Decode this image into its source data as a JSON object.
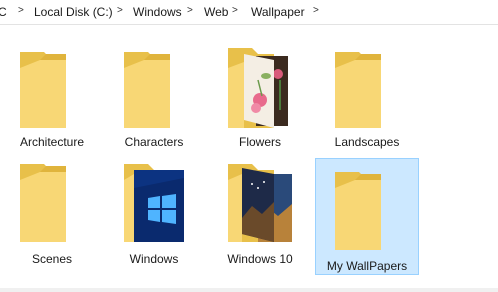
{
  "breadcrumb": {
    "items": [
      {
        "label": "C"
      },
      {
        "label": "Local Disk (C:)"
      },
      {
        "label": "Windows"
      },
      {
        "label": "Web"
      },
      {
        "label": "Wallpaper"
      }
    ],
    "separator": ">"
  },
  "folders": [
    {
      "name": "Architecture",
      "preview": "none"
    },
    {
      "name": "Characters",
      "preview": "none"
    },
    {
      "name": "Flowers",
      "preview": "flower-photo"
    },
    {
      "name": "Landscapes",
      "preview": "none"
    },
    {
      "name": "Scenes",
      "preview": "none"
    },
    {
      "name": "Windows",
      "preview": "windows-logo-wallpaper"
    },
    {
      "name": "Windows 10",
      "preview": "landscape-photo"
    },
    {
      "name": "My WallPapers",
      "preview": "none",
      "selected": true
    }
  ],
  "colors": {
    "folder_back": "#e8c04a",
    "folder_front": "#f8d775",
    "selection_fill": "#cce8ff",
    "selection_border": "#99d1ff"
  }
}
